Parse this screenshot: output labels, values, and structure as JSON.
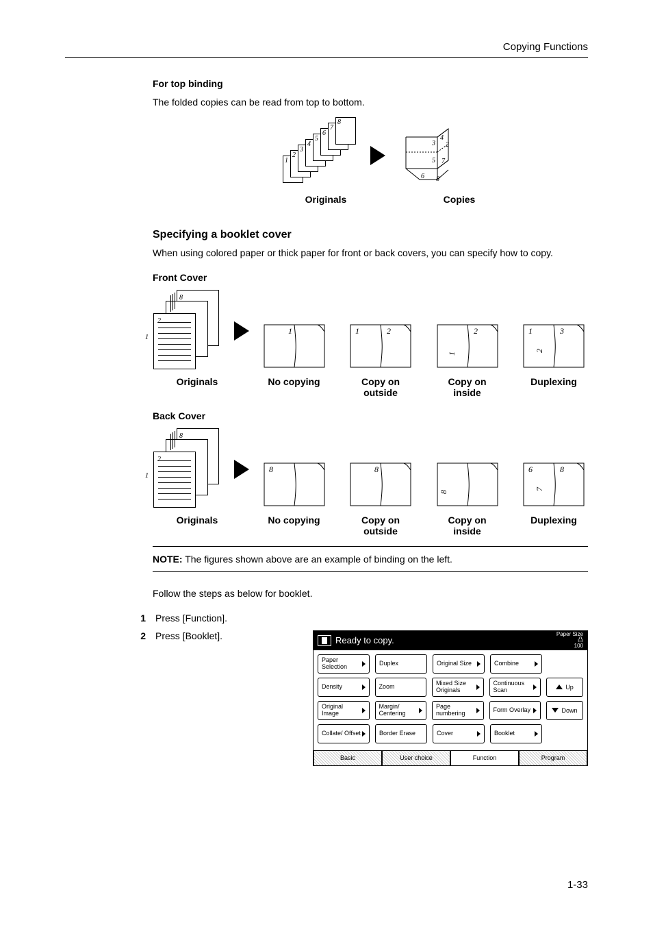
{
  "header": {
    "right": "Copying Functions"
  },
  "topBinding": {
    "heading": "For top binding",
    "para": "The folded copies can be read from top to bottom.",
    "origLabel": "Originals",
    "copyLabel": "Copies"
  },
  "bookletCover": {
    "heading": "Specifying a booklet cover",
    "para": "When using colored paper or thick paper for front or back covers, you can specify how to copy."
  },
  "front": {
    "heading": "Front Cover",
    "labels": [
      "Originals",
      "No copying",
      "Copy on\noutside",
      "Copy on\ninside",
      "Duplexing"
    ]
  },
  "back": {
    "heading": "Back Cover",
    "labels": [
      "Originals",
      "No copying",
      "Copy on\noutside",
      "Copy on\ninside",
      "Duplexing"
    ]
  },
  "note": {
    "prefix": "NOTE:",
    "text": "The figures shown above are an example of binding on the left."
  },
  "follow": "Follow the steps as below for booklet.",
  "steps": [
    {
      "n": "1",
      "text": "Press [Function]."
    },
    {
      "n": "2",
      "text": "Press [Booklet]."
    }
  ],
  "panel": {
    "title": "Ready to copy.",
    "paperSize": "Paper Size",
    "units": "凸",
    "pct": "100",
    "rows": [
      [
        "Paper Selection",
        "Duplex",
        "Original Size",
        "Combine"
      ],
      [
        "Density",
        "Zoom",
        "Mixed Size Originals",
        "Continuous Scan"
      ],
      [
        "Original Image",
        "Margin/ Centering",
        "Page numbering",
        "Form Overlay"
      ],
      [
        "Collate/ Offset",
        "Border Erase",
        "Cover",
        "Booklet"
      ]
    ],
    "nav": {
      "up": "Up",
      "down": "Down"
    },
    "tabs": [
      "Basic",
      "User choice",
      "Function",
      "Program"
    ]
  },
  "footer": "1-33"
}
